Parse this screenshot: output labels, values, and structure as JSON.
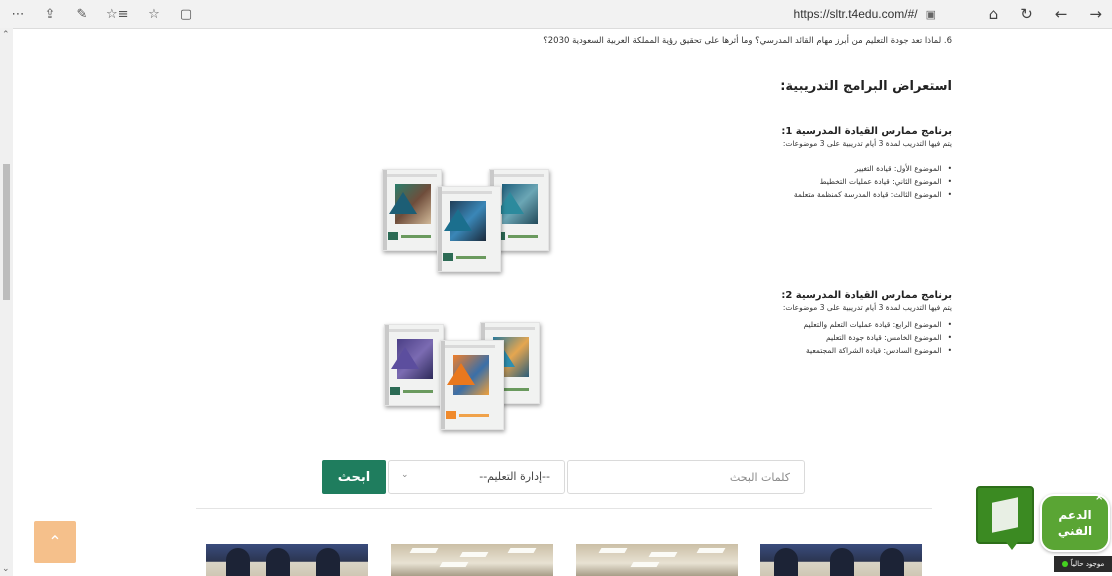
{
  "browser": {
    "toolbar_glyphs": [
      "⋯",
      "⇪",
      "✎",
      "☆≡",
      "☆",
      "▢"
    ],
    "url": "https://sltr.t4edu.com/#/",
    "right_glyphs": [
      "⌂",
      "↻",
      "←",
      "→"
    ]
  },
  "page": {
    "q6_text": "6. لماذا تعد جودة التعليم من أبرز مهام القائد المدرسي؟ وما أثرها على تحقيق رؤية المملكة العربية السعودية 2030؟",
    "section_heading": "استعراض البرامج التدريبية:",
    "programs": [
      {
        "title": "برنامج ممارس القيادة المدرسية 1:",
        "desc": "يتم فيها التدريب لمدة 3 أيام تدريبية على 3 موضوعات:",
        "topics": [
          "الموضوع الأول: قيادة التغيير",
          "الموضوع الثاني: قيادة عمليات التخطيط",
          "الموضوع الثالث: قيادة المدرسة كمنظمة متعلمة"
        ]
      },
      {
        "title": "برنامج ممارس القيادة المدرسية 2:",
        "desc": "يتم فيها التدريب لمدة 3 أيام تدريبية على 3 موضوعات:",
        "topics": [
          "الموضوع الرابع: قيادة عمليات التعلم والتعليم",
          "الموضوع الخامس: قيادة جودة التعليم",
          "الموضوع السادس: قيادة الشراكة المجتمعية"
        ]
      }
    ]
  },
  "search": {
    "button": "ابحث",
    "select_value": "--إدارة التعليم--",
    "input_placeholder": "كلمات البحث"
  },
  "widgets": {
    "to_top": "⌃",
    "support_line1": "الدعم",
    "support_line2": "الفني",
    "support_close": "×",
    "status": "موجود حالياً"
  },
  "colors": {
    "accent": "#1f7d5e",
    "support_green": "#5aa534",
    "to_top": "#f5c08b"
  }
}
